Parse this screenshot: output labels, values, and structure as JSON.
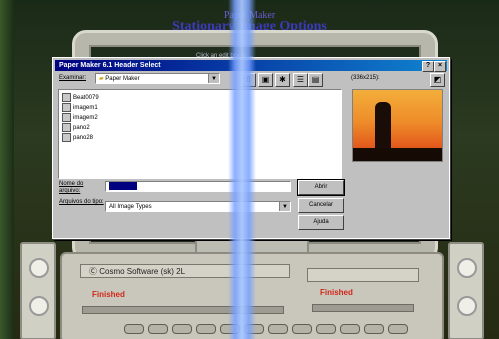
{
  "background": {
    "app_title": "Paper Maker",
    "screen_title": "Stationary Image Options",
    "hint": "Click an edit box to ...",
    "drive_label": "Ⓒ Cosmo Software (sk) 2L",
    "status_left": "Finished",
    "status_right": "Finished"
  },
  "dialog": {
    "title": "Paper Maker 6.1 Header Select",
    "look_in_label": "Examinar:",
    "look_in_value": "Paper Maker",
    "preview_size": "(336x215):",
    "files": [
      "Beat0079",
      "imagem1",
      "imagem2",
      "pano2",
      "pano28"
    ],
    "filename_label": "Nome do arquivo:",
    "filename_value": "",
    "filetype_label": "Arquivos do tipo:",
    "filetype_value": "All Image Types",
    "open_button": "Abrir",
    "cancel_button": "Cancelar",
    "help_button": "Ajuda"
  },
  "colors": {
    "titlebar_start": "#000080",
    "titlebar_end": "#1084d0",
    "status_red": "#d2261a",
    "title_blue": "#3c3ab8"
  },
  "icons": {
    "folder": "folder-icon",
    "up_folder": "up-folder-icon",
    "new_folder": "new-folder-icon",
    "list_view": "list-view-icon",
    "details_view": "details-view-icon",
    "preview_toggle": "preview-toggle-icon",
    "help": "help-icon",
    "close": "close-icon",
    "file": "image-file-icon"
  }
}
